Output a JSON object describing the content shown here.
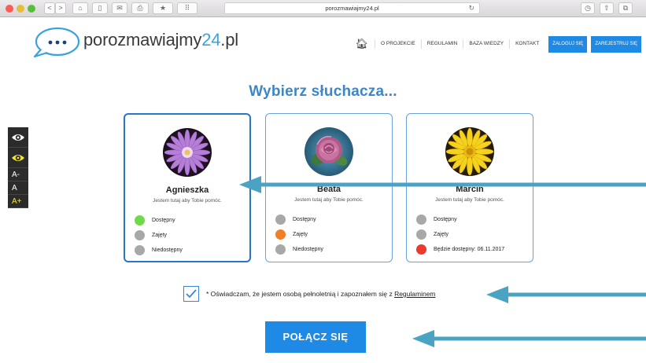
{
  "browser": {
    "url": "porozmawiajmy24.pl",
    "controls": [
      "<",
      ">",
      "⌂",
      "▯",
      "✉",
      "⎙",
      "★",
      "⠿"
    ],
    "right_controls": [
      "◷",
      "⇧",
      "⧉"
    ]
  },
  "logo": {
    "text_a": "porozmawiajmy",
    "text_b": "24",
    "text_c": ".pl",
    "bubble": "..."
  },
  "nav": {
    "items": [
      "O PROJEKCIE",
      "REGULAMIN",
      "BAZA WIEDZY",
      "KONTAKT"
    ],
    "login": "ZALOGUJ SIĘ",
    "register": "ZAREJESTRUJ SIĘ"
  },
  "title": "Wybierz słuchacza...",
  "a11y": {
    "smaller": "A-",
    "normal": "A",
    "larger": "A+"
  },
  "cards": [
    {
      "name": "Agnieszka",
      "subtitle": "Jestem tutaj aby Tobie pomóc.",
      "statuses": [
        {
          "label": "Dostępny",
          "color": "#6fdb4a"
        },
        {
          "label": "Zajęty",
          "color": "#a8a8a8"
        },
        {
          "label": "Niedostępny",
          "color": "#a8a8a8"
        }
      ]
    },
    {
      "name": "Beata",
      "subtitle": "Jestem tutaj aby Tobie pomóc.",
      "statuses": [
        {
          "label": "Dostępny",
          "color": "#a8a8a8"
        },
        {
          "label": "Zajęty",
          "color": "#f07f2a"
        },
        {
          "label": "Niedostępny",
          "color": "#a8a8a8"
        }
      ]
    },
    {
      "name": "Marcin",
      "subtitle": "Jestem tutaj aby Tobie pomóc.",
      "statuses": [
        {
          "label": "Dostępny",
          "color": "#a8a8a8"
        },
        {
          "label": "Zajęty",
          "color": "#a8a8a8"
        },
        {
          "label": "Będzie dostępny: 06.11.2017",
          "color": "#ec3a2d"
        }
      ]
    }
  ],
  "consent": {
    "text": "* Oświadczam, że jestem osobą pełnoletnią i zapoznałem się z ",
    "link": "Regulaminem",
    "checked": true
  },
  "connect_button": "POŁĄCZ SIĘ",
  "colors": {
    "accent": "#1e8ae6",
    "title": "#3e86c6",
    "arrow": "#4aa3c2"
  }
}
